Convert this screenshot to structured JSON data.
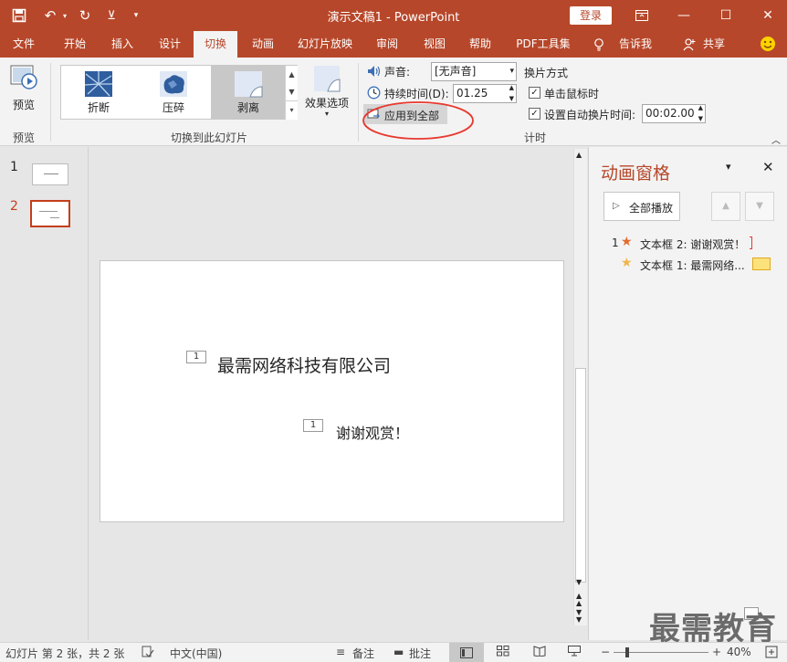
{
  "titlebar": {
    "title": "演示文稿1  -  PowerPoint",
    "login_label": "登录"
  },
  "tabs": [
    "文件",
    "开始",
    "插入",
    "设计",
    "切换",
    "动画",
    "幻灯片放映",
    "审阅",
    "视图",
    "帮助",
    "PDF工具集",
    "告诉我",
    "共享"
  ],
  "ribbon": {
    "preview_label": "预览",
    "preview_group_label": "预览",
    "gallery": {
      "items": [
        "折断",
        "压碎",
        "剥离"
      ],
      "selected": "剥离",
      "group_label": "切换到此幻灯片"
    },
    "effect_options_label": "效果选项",
    "timing": {
      "sound_label": "声音:",
      "sound_value": "[无声音]",
      "duration_label": "持续时间(D):",
      "duration_value": "01.25",
      "apply_all_label": "应用到全部",
      "advance_label": "换片方式",
      "on_click_label": "单击鼠标时",
      "after_label": "设置自动换片时间:",
      "after_value": "00:02.00",
      "group_label": "计时"
    }
  },
  "thumbnails": [
    {
      "num": "1",
      "active": false
    },
    {
      "num": "2",
      "active": true
    }
  ],
  "slide": {
    "marker1": "1",
    "text1": "最需网络科技有限公司",
    "marker2": "1",
    "text2": "谢谢观赏！"
  },
  "anim_pane": {
    "title": "动画窗格",
    "play_all_label": "全部播放",
    "items": [
      {
        "num": "1",
        "label": "文本框 2: 谢谢观赏！"
      },
      {
        "num": "",
        "label": "文本框 1: 最需网络..."
      }
    ]
  },
  "statusbar": {
    "slide_info": "幻灯片 第 2 张，共 2 张",
    "language": "中文(中国)",
    "notes_label": "备注",
    "comments_label": "批注",
    "zoom": "40%"
  },
  "watermark": "最需教育",
  "colors": {
    "accent": "#b7472a",
    "highlight_ellipse": "#e8382e"
  }
}
